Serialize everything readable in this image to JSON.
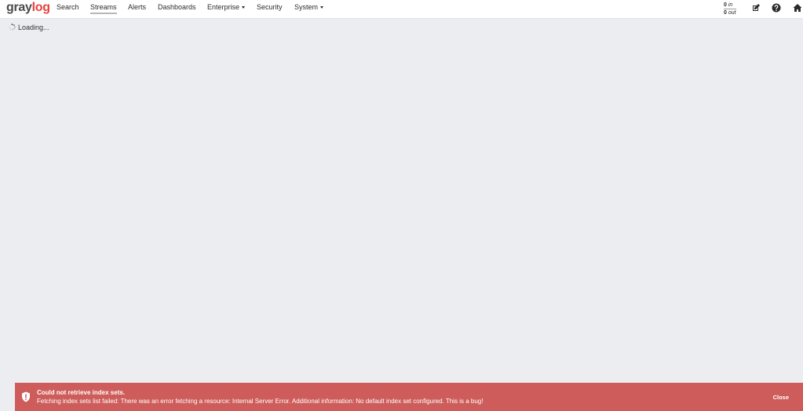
{
  "brand": {
    "part1": "gray",
    "part2": "log"
  },
  "nav": {
    "search": "Search",
    "streams": "Streams",
    "alerts": "Alerts",
    "dashboards": "Dashboards",
    "enterprise": "Enterprise",
    "security": "Security",
    "system": "System"
  },
  "throughput": {
    "in_value": "0",
    "in_label": "in",
    "out_value": "0",
    "out_label": "out"
  },
  "header_icons": [
    "edit-icon",
    "help-icon",
    "home-icon"
  ],
  "main": {
    "loading_text": "Loading..."
  },
  "alert": {
    "title": "Could not retrieve index sets.",
    "message": "Fetching index sets list failed: There was an error fetching a resource: Internal Server Error. Additional information: No default index set configured. This is a bug!",
    "close_label": "Close"
  },
  "colors": {
    "background": "#ecedf1",
    "navbar": "#ffffff",
    "brand_accent": "#e8403f",
    "alert_bg": "#cd5c5a",
    "alert_text": "#ffffff"
  }
}
